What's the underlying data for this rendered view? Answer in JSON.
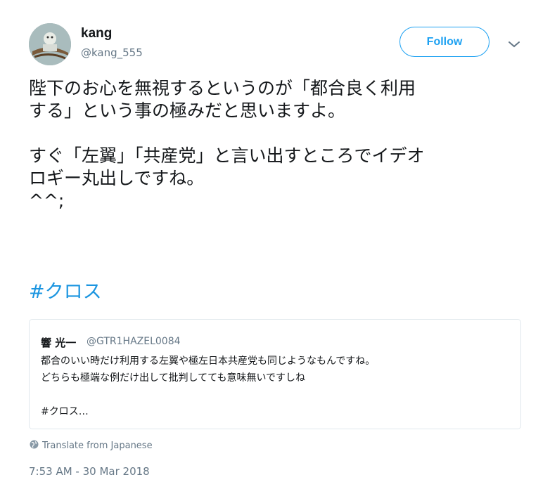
{
  "author": {
    "display_name": "kang",
    "handle": "@kang_555"
  },
  "follow_label": "Follow",
  "tweet": {
    "text": "陛下のお心を無視するというのが「都合良く利用\nする」という事の極みだと思いますよ。\n\nすぐ「左翼」「共産党」と言い出すところでイデオ\nロギー丸出しですね。\n^^;",
    "hashtag": "#クロス"
  },
  "quoted": {
    "display_name": "響 光一",
    "handle": "@GTR1HAZEL0084",
    "lines": [
      "都合のいい時だけ利用する左翼や極左日本共産党も同じようなもんですね。",
      "どちらも極端な例だけ出して批判してても意味無いですしね",
      "",
      "#クロス…"
    ]
  },
  "translate_label": "Translate from Japanese",
  "timestamp": "7:53 AM - 30 Mar 2018",
  "colors": {
    "accent": "#1da1f2",
    "hashtag": "#1b95e0",
    "secondary_text": "#657786",
    "border": "#e1e8ed"
  },
  "icons": [
    "caret-down-icon",
    "globe-icon"
  ]
}
